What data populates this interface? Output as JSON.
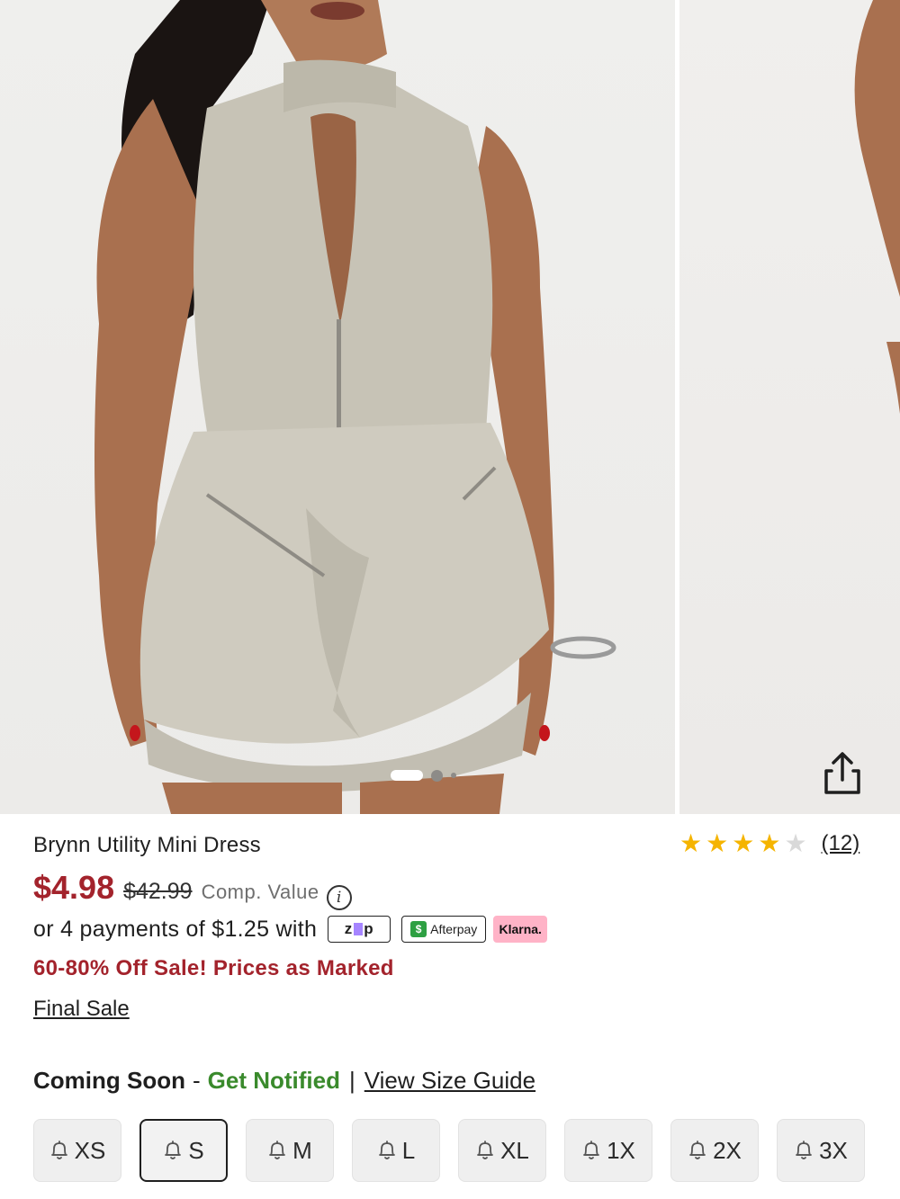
{
  "gallery": {
    "image_alt": "Model wearing sage utility mini dress",
    "active_slide": 1,
    "slide_count": 3
  },
  "product": {
    "title": "Brynn Utility Mini Dress",
    "rating": 4,
    "rating_max": 5,
    "review_count": "(12)"
  },
  "pricing": {
    "sale_price": "$4.98",
    "original_price": "$42.99",
    "comp_value_label": "Comp. Value",
    "info_icon": "i"
  },
  "payments": {
    "text": "or 4 payments of $1.25 with",
    "zip_label": "zip",
    "afterpay_label": "Afterpay",
    "klarna_label": "Klarna."
  },
  "promo_text": "60-80% Off Sale! Prices as Marked",
  "final_sale_text": "Final Sale",
  "size_section": {
    "status": "Coming Soon",
    "dash": "-",
    "notify": "Get Notified",
    "pipe": "|",
    "guide": "View Size Guide",
    "sizes": [
      "XS",
      "S",
      "M",
      "L",
      "XL",
      "1X",
      "2X",
      "3X"
    ],
    "selected": "S"
  },
  "colors": {
    "sale_red": "#a3232c",
    "notify_green": "#3a8a2c",
    "star_gold": "#f5b400"
  }
}
